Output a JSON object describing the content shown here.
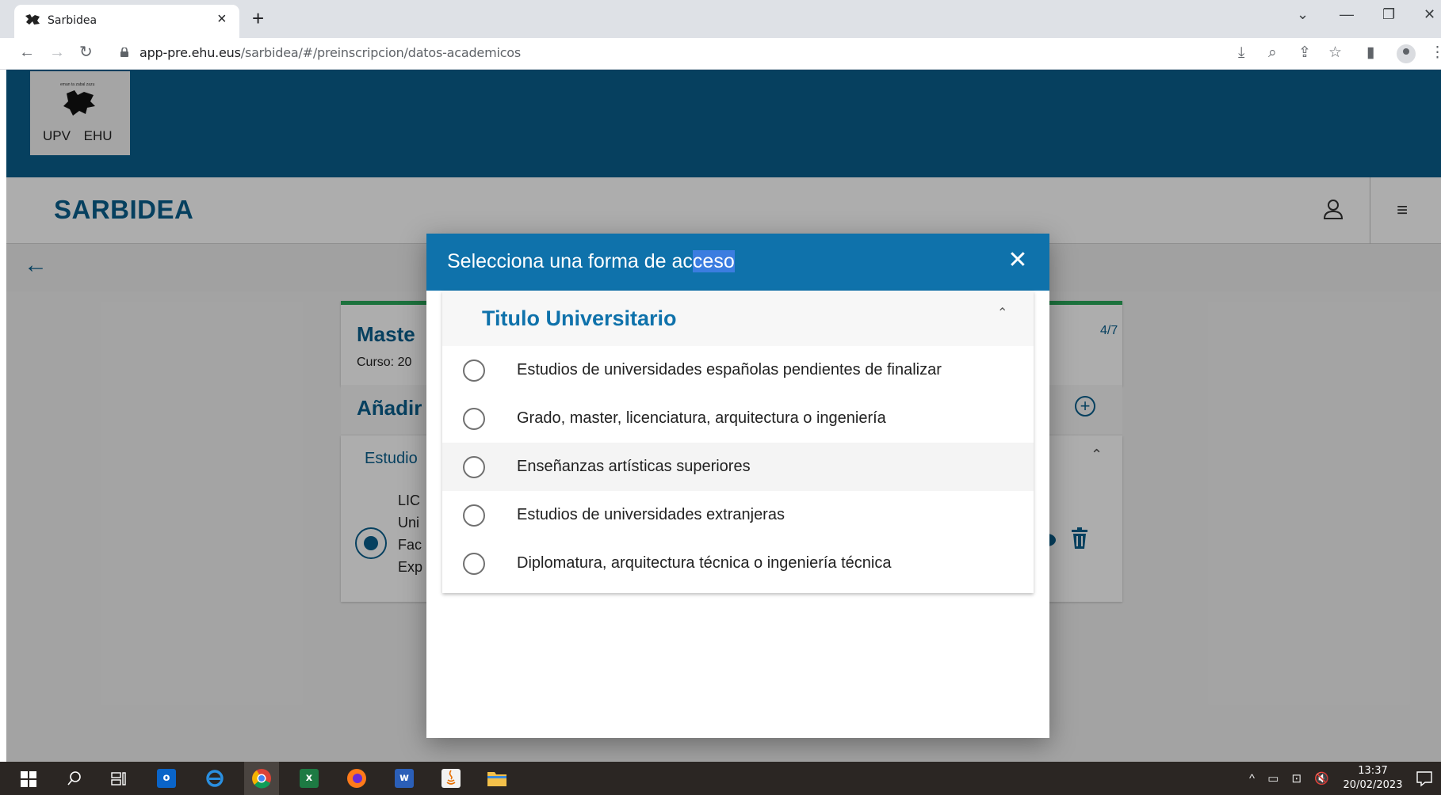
{
  "browser": {
    "tab_title": "Sarbidea",
    "tab_close": "×",
    "new_tab": "+",
    "url_host": "app-pre.ehu.eus",
    "url_path": "/sarbidea/#/preinscripcion/datos-academicos",
    "window_controls": {
      "dropdown": "⌄",
      "minimize": "—",
      "restore": "❐",
      "close": "✕"
    },
    "nav": {
      "back": "←",
      "forward": "→",
      "reload": "↻"
    },
    "toolbar_icons": {
      "install": "⤓",
      "zoom": "⌕",
      "share": "⇪",
      "bookmark": "☆",
      "sidebar": "▮",
      "menu": "⋮"
    }
  },
  "site": {
    "logo_motto": "eman ta zabal zazu",
    "logo_text": "UPV EHU",
    "brand": "SARBIDEA",
    "menu_icon": "≡",
    "back_icon": "←"
  },
  "background_cards": {
    "title": "Maste",
    "course": "Curso: 20",
    "step": "4/7",
    "add_title": "Añadir",
    "add_icon": "+",
    "study_title": "Estudio",
    "study_chevron": "⌃",
    "study_lines": [
      "LIC",
      "Uni",
      "Fac",
      "Exp"
    ]
  },
  "modal": {
    "title_plain": "Selecciona una forma de ac",
    "title_selected": "ceso",
    "close_icon": "✕",
    "panel_title": "Titulo Universitario",
    "panel_chevron": "⌃",
    "options": [
      {
        "label": "Estudios de universidades españolas pendientes de finalizar"
      },
      {
        "label": "Grado, master, licenciatura, arquitectura o ingeniería"
      },
      {
        "label": "Enseñanzas artísticas superiores"
      },
      {
        "label": "Estudios de universidades extranjeras"
      },
      {
        "label": "Diplomatura, arquitectura técnica o ingeniería técnica"
      }
    ]
  },
  "taskbar": {
    "excel": "x",
    "word": "w",
    "outlook": "o",
    "tray_icons": "^ ▭ ⊡ 🔇",
    "time": "13:37",
    "date": "20/02/2023"
  }
}
